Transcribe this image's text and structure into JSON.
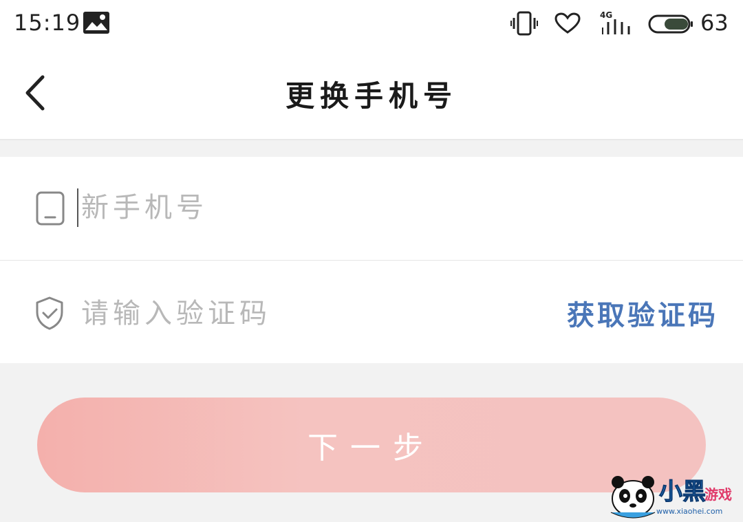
{
  "status_bar": {
    "time": "15:19",
    "battery_level": "63",
    "network": "4G"
  },
  "header": {
    "title": "更换手机号"
  },
  "form": {
    "phone_placeholder": "新手机号",
    "code_placeholder": "请输入验证码",
    "get_code_label": "获取验证码"
  },
  "actions": {
    "next_label": "下一步"
  },
  "watermark": {
    "brand": "小黑",
    "sub": "游戏",
    "url": "www.xiaohei.com"
  },
  "colors": {
    "accent_link": "#4a76b8",
    "button_pink": "#f4b8b6",
    "background": "#f2f2f2"
  }
}
